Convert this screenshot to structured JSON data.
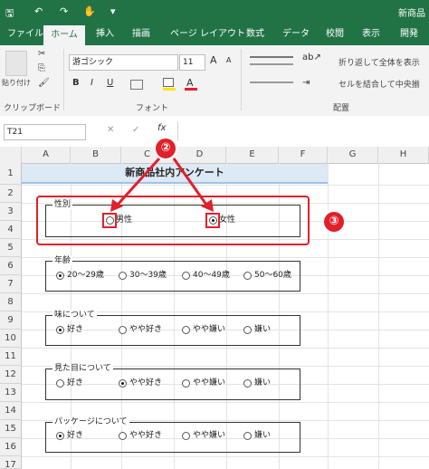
{
  "titlebar": {
    "title": "新商品"
  },
  "tabs": [
    "ファイル",
    "ホーム",
    "挿入",
    "描画",
    "ページ レイアウト",
    "数式",
    "データ",
    "校閲",
    "表示",
    "開発"
  ],
  "ribbon": {
    "clipboard_label": "クリップボード",
    "paste_label": "貼り付け",
    "font_label": "フォント",
    "font_name": "游ゴシック",
    "font_size": "11",
    "bold": "B",
    "italic": "I",
    "underline": "U",
    "font_grow": "A",
    "font_shrink": "A",
    "fontcolor_glyph": "A",
    "fontcolor_color": "#e0202a",
    "fill_color": "#ffe600",
    "wrap_text": "折り返して全体を表示",
    "merge_center": "セルを結合して中央揃",
    "alignment_label": "配置"
  },
  "formula_bar": {
    "name_box": "T21",
    "fx": "fx",
    "cancel": "✕",
    "enter": "✓"
  },
  "grid": {
    "columns": [
      "A",
      "B",
      "C",
      "D",
      "E",
      "F",
      "G",
      "H"
    ],
    "rows": [
      "1",
      "2",
      "3",
      "4",
      "5",
      "6",
      "7",
      "8",
      "9",
      "10",
      "11",
      "12",
      "13",
      "14",
      "15",
      "16",
      "17"
    ],
    "title": "新商品社内アンケート"
  },
  "groups": [
    {
      "label": "性別",
      "options": [
        "男性",
        "女性"
      ],
      "selected": 1
    },
    {
      "label": "年齢",
      "options": [
        "20～29歳",
        "30～39歳",
        "40～49歳",
        "50～60歳"
      ],
      "selected": 0
    },
    {
      "label": "味について",
      "options": [
        "好き",
        "やや好き",
        "やや嫌い",
        "嫌い"
      ],
      "selected": 0
    },
    {
      "label": "見た目について",
      "options": [
        "好き",
        "やや好き",
        "やや嫌い",
        "嫌い"
      ],
      "selected": 1
    },
    {
      "label": "パッケージについて",
      "options": [
        "好き",
        "やや好き",
        "やや嫌い",
        "嫌い"
      ],
      "selected": 0
    }
  ],
  "annotations": {
    "callout2": "②",
    "callout3": "③",
    "accent": "#e0202a"
  }
}
